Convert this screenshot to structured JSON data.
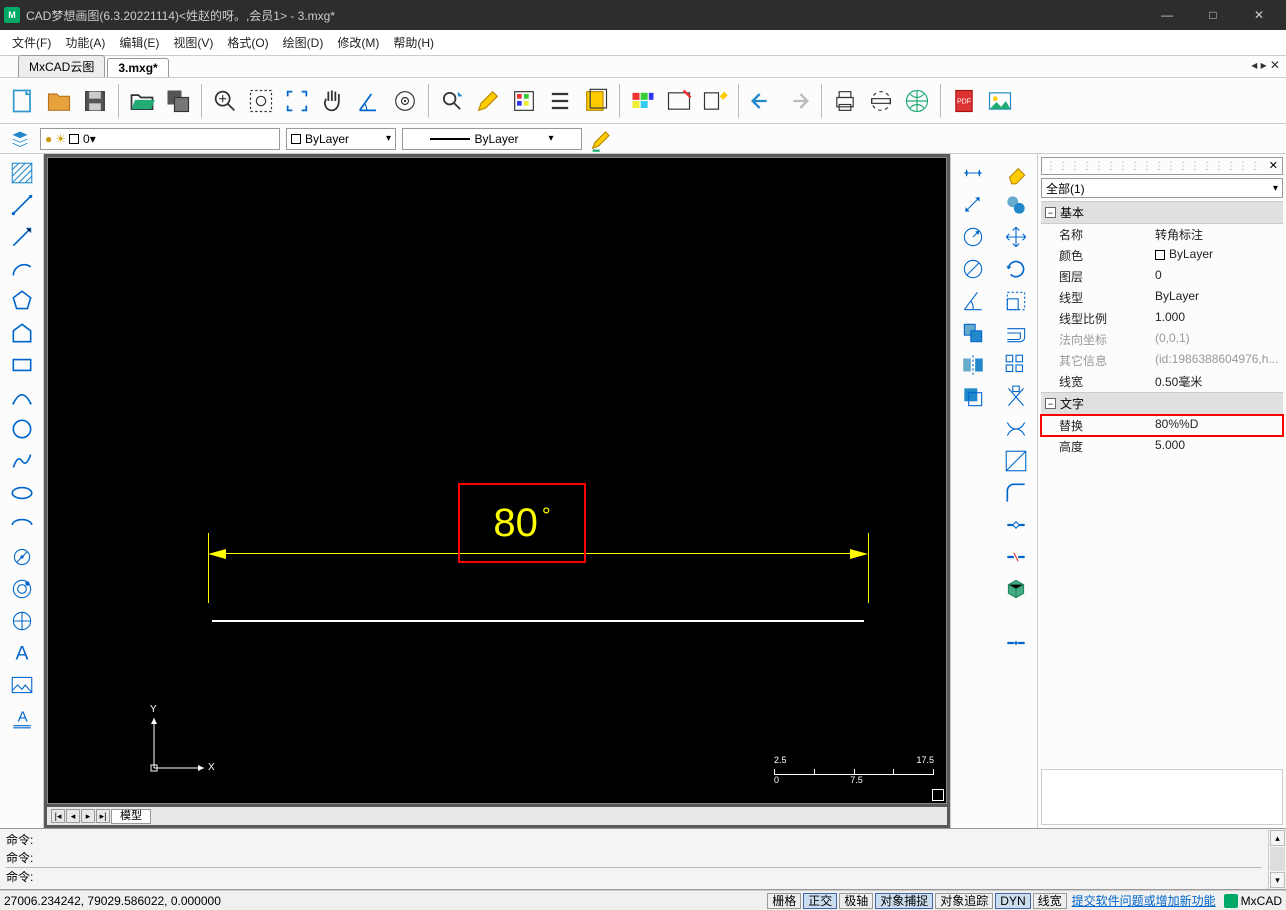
{
  "titlebar": {
    "title": "CAD梦想画图(6.3.20221114)<姓赵的呀。,会员1> - 3.mxg*"
  },
  "menu": [
    "文件(F)",
    "功能(A)",
    "编辑(E)",
    "视图(V)",
    "格式(O)",
    "绘图(D)",
    "修改(M)",
    "帮助(H)"
  ],
  "tabs": {
    "tab1": "MxCAD云图",
    "tab2": "3.mxg*"
  },
  "layer": {
    "name": "0",
    "linetype": "ByLayer",
    "lineweight": "ByLayer"
  },
  "canvas": {
    "dim_value": "80",
    "dim_suffix": "°",
    "ucs_y": "Y",
    "ucs_x": "X",
    "ruler": [
      "0",
      "2.5",
      "7.5",
      "17.5"
    ],
    "model_tab": "模型"
  },
  "props": {
    "selector": "全部(1)",
    "section_basic": "基本",
    "name_k": "名称",
    "name_v": "转角标注",
    "color_k": "颜色",
    "color_v": "ByLayer",
    "layer_k": "图层",
    "layer_v": "0",
    "ltype_k": "线型",
    "ltype_v": "ByLayer",
    "ltscale_k": "线型比例",
    "ltscale_v": "1.000",
    "normal_k": "法向坐标",
    "normal_v": "(0,0,1)",
    "other_k": "其它信息",
    "other_v": "(id:1986388604976,h...",
    "lweight_k": "线宽",
    "lweight_v": "0.50毫米",
    "section_text": "文字",
    "replace_k": "替换",
    "replace_v": "80%%D",
    "height_k": "高度",
    "height_v": "5.000"
  },
  "cmd": {
    "label": "命令:"
  },
  "status": {
    "coords": "27006.234242,  79029.586022,  0.000000",
    "grid": "栅格",
    "ortho": "正交",
    "polar": "极轴",
    "osnap": "对象捕捉",
    "otrack": "对象追踪",
    "dyn": "DYN",
    "lw": "线宽",
    "feedback": "提交软件问题或增加新功能",
    "brand": "MxCAD"
  }
}
